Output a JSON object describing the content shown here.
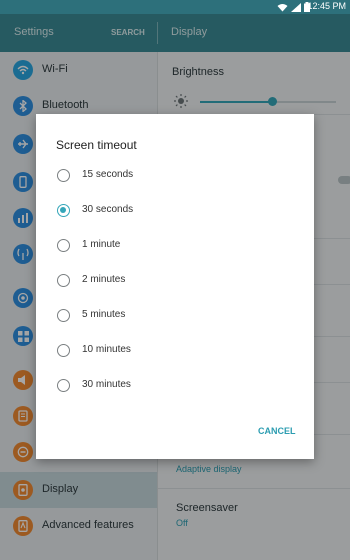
{
  "status_bar": {
    "time": "12:45 PM",
    "icons": [
      "wifi-icon",
      "signal-icon",
      "battery-icon"
    ]
  },
  "header": {
    "left_title": "Settings",
    "search_label": "SEARCH",
    "right_title": "Display"
  },
  "sidebar": {
    "items": [
      {
        "label": "Wi-Fi",
        "icon": "wifi-icon",
        "color": "#2aa7e0"
      },
      {
        "label": "Bluetooth",
        "icon": "bluetooth-icon",
        "color": "#2e8fe0"
      },
      {
        "label": "",
        "icon": "airplane-icon",
        "color": "#2e8fe0"
      },
      {
        "label": "",
        "icon": "phone-icon",
        "color": "#2e8fe0"
      },
      {
        "label": "",
        "icon": "data-usage-icon",
        "color": "#2e8fe0"
      },
      {
        "label": "",
        "icon": "hotspot-icon",
        "color": "#2e8fe0"
      },
      {
        "label": "",
        "icon": "nfc-icon",
        "color": "#2e8fe0"
      },
      {
        "label": "",
        "icon": "apps-icon",
        "color": "#2e8fe0"
      },
      {
        "label": "",
        "icon": "sound-icon",
        "color": "#f08a34"
      },
      {
        "label": "",
        "icon": "notifications-icon",
        "color": "#f08a34"
      },
      {
        "label": "",
        "icon": "do-not-disturb-icon",
        "color": "#f08a34"
      },
      {
        "label": "Display",
        "icon": "display-icon",
        "color": "#f08a34",
        "active": true
      },
      {
        "label": "Advanced features",
        "icon": "advanced-features-icon",
        "color": "#f08a34"
      }
    ]
  },
  "display_panel": {
    "brightness_label": "Brightness",
    "brightness_level": 0.53,
    "adaptive_display_label": "Adaptive display",
    "screensaver_label": "Screensaver",
    "screensaver_value": "Off"
  },
  "dialog": {
    "title": "Screen timeout",
    "options": [
      "15 seconds",
      "30 seconds",
      "1 minute",
      "2 minutes",
      "5 minutes",
      "10 minutes",
      "30 minutes"
    ],
    "selected_index": 1,
    "cancel_label": "CANCEL"
  },
  "colors": {
    "accent": "#35a6b9",
    "header": "#3b8a95",
    "status_bar": "#2d707b"
  }
}
